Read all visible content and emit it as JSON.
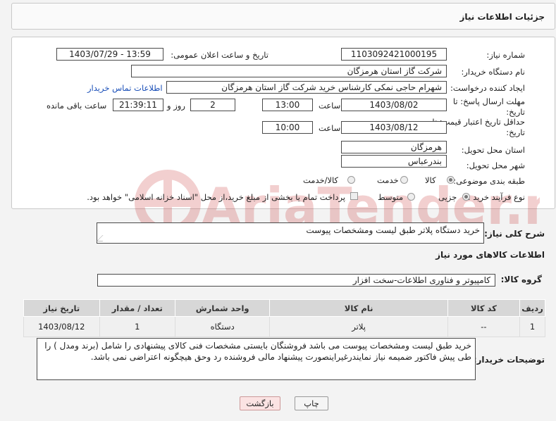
{
  "header": {
    "title": "جزئیات اطلاعات نیاز"
  },
  "form": {
    "need_number": {
      "label": "شماره نیاز:",
      "value": "1103092421000195"
    },
    "announce_datetime": {
      "label": "تاریخ و ساعت اعلان عمومی:",
      "value": "1403/07/29 - 13:59"
    },
    "buyer_org": {
      "label": "نام دستگاه خریدار:",
      "value": "شرکت گاز استان هرمزگان"
    },
    "requester": {
      "label": "ایجاد کننده درخواست:",
      "value": "شهرام حاجی نمکی کارشناس خرید شرکت گاز استان هرمزگان",
      "contact_link": "اطلاعات تماس خریدار"
    },
    "reply_deadline": {
      "label": "مهلت ارسال پاسخ: تا تاریخ:",
      "date": "1403/08/02",
      "time_label": "ساعت",
      "time": "13:00",
      "days": "2",
      "days_label": "روز و",
      "remaining": "21:39:11",
      "remaining_label": "ساعت باقی مانده"
    },
    "price_validity": {
      "label": "حداقل تاریخ اعتبار قیمت: تا تاریخ:",
      "date": "1403/08/12",
      "time_label": "ساعت",
      "time": "10:00"
    },
    "delivery_province": {
      "label": "استان محل تحویل:",
      "value": "هرمزگان"
    },
    "delivery_city": {
      "label": "شهر محل تحویل:",
      "value": "بندرعباس"
    },
    "category": {
      "label": "طبقه بندی موضوعی:",
      "options": [
        "کالا",
        "خدمت",
        "کالا/خدمت"
      ],
      "selected": "کالا"
    },
    "purchase_type": {
      "label": "نوع فرآیند خرید :",
      "options": [
        "جزیی",
        "متوسط"
      ],
      "selected": "جزیی",
      "payment_note": "پرداخت تمام یا بخشی از مبلغ خرید،از محل \"اسناد خزانه اسلامی\" خواهد بود."
    }
  },
  "summary": {
    "label": "شرح کلی نیاز:",
    "value": "خرید دستگاه پلاتر طبق لیست ومشخصات پیوست"
  },
  "goods_section": {
    "title": "اطلاعات کالاهای مورد نیاز",
    "group_label": "گروه کالا:",
    "group_value": "کامپیوتر و فناوری اطلاعات-سخت افزار"
  },
  "table": {
    "headers": [
      "ردیف",
      "کد کالا",
      "نام کالا",
      "واحد شمارش",
      "تعداد / مقدار",
      "تاریخ نیاز"
    ],
    "rows": [
      [
        "1",
        "--",
        "پلاتر",
        "دستگاه",
        "1",
        "1403/08/12"
      ]
    ]
  },
  "buyer_notes": {
    "label": "توضیحات خریدار:",
    "value": "خرید طبق لیست ومشخصات پیوست می باشد فروشنگان بایستی مشخصات فنی کالای پیشنهادی را شامل (برند ومدل ) را طی پیش فاکتور ضمیمه نیاز نمایندرغیراینصورت پیشنهاد مالی فروشنده رد وحق هیچگونه اعتراضی نمی باشد."
  },
  "buttons": {
    "print": "چاپ",
    "back": "بازگشت"
  },
  "watermark": {
    "text": "AriaTender.net",
    "color": "#c62828"
  }
}
